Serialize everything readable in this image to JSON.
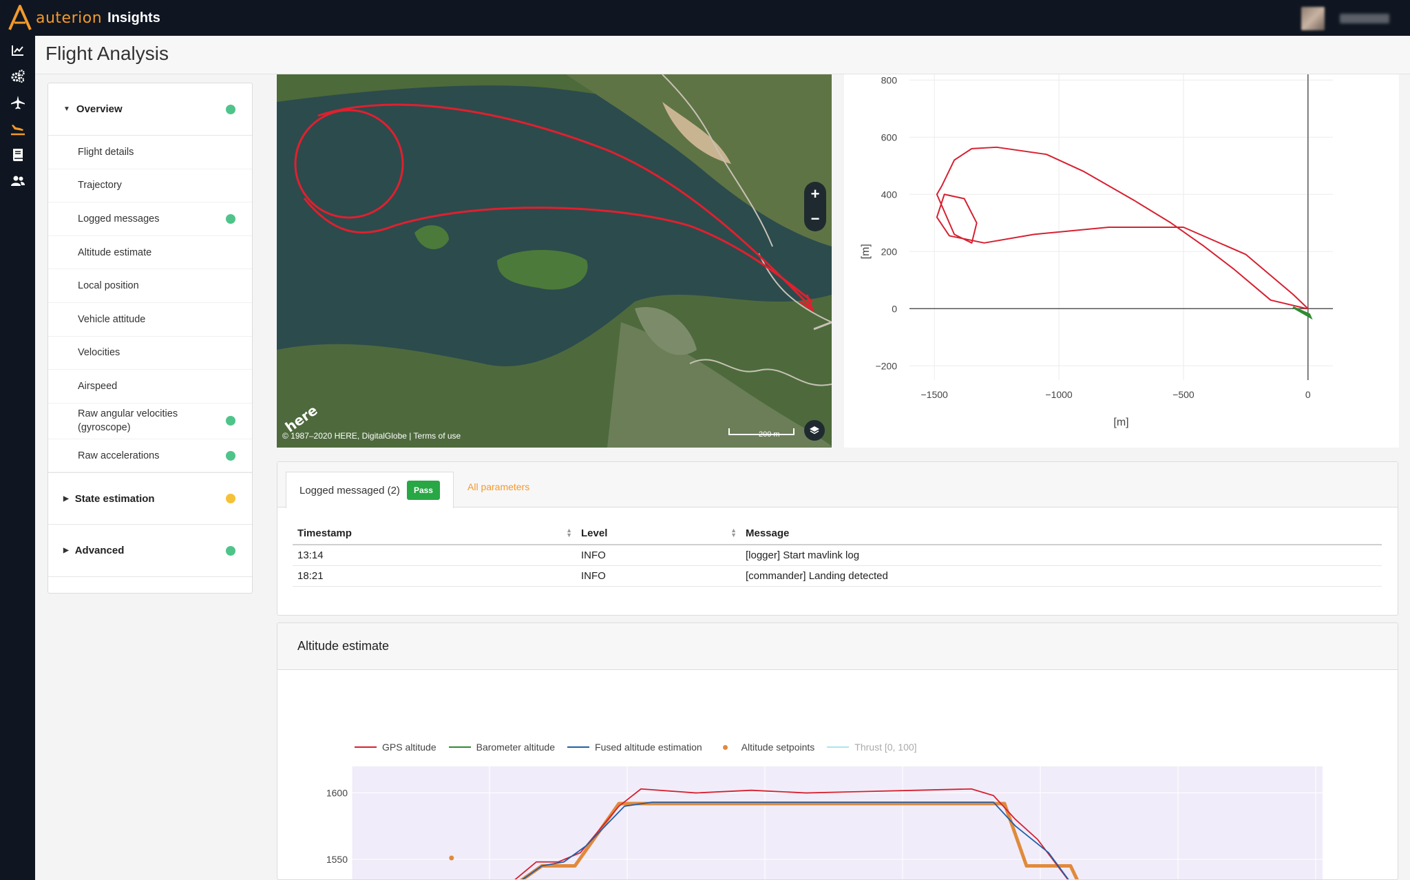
{
  "app": {
    "brand": "auterion",
    "product": "Insights",
    "page_title": "Flight Analysis"
  },
  "nav_icons": [
    "chart-line-icon",
    "cogs-icon",
    "plane-icon",
    "plane-landing-icon",
    "book-icon",
    "users-icon"
  ],
  "sidebar": {
    "sections": [
      {
        "label": "Overview",
        "status": "green",
        "expanded": true
      },
      {
        "label": "State estimation",
        "status": "yellow",
        "expanded": false
      },
      {
        "label": "Advanced",
        "status": "green",
        "expanded": false
      }
    ],
    "items": [
      {
        "label": "Flight details",
        "status": ""
      },
      {
        "label": "Trajectory",
        "status": ""
      },
      {
        "label": "Logged messages",
        "status": "green"
      },
      {
        "label": "Altitude estimate",
        "status": ""
      },
      {
        "label": "Local position",
        "status": ""
      },
      {
        "label": "Vehicle attitude",
        "status": ""
      },
      {
        "label": "Velocities",
        "status": ""
      },
      {
        "label": "Airspeed",
        "status": ""
      },
      {
        "label": "Raw angular velocities (gyroscope)",
        "status": "green"
      },
      {
        "label": "Raw accelerations",
        "status": "green"
      }
    ]
  },
  "map": {
    "zoom_in": "+",
    "zoom_out": "−",
    "attribution": "© 1987–2020 HERE, DigitalGlobe | Terms of use",
    "scale": "200 m",
    "provider_logo": "here"
  },
  "trajectory_plot": {
    "chart_data": {
      "type": "line",
      "xlabel": "[m]",
      "ylabel": "[m]",
      "xticks": [
        "−1500",
        "−1000",
        "−500",
        "0"
      ],
      "yticks": [
        "800",
        "600",
        "400",
        "200",
        "0",
        "−200"
      ],
      "xlim": [
        -1600,
        100
      ],
      "ylim": [
        -250,
        820
      ],
      "series": [
        {
          "color": "#d62030",
          "x": [
            -5,
            -150,
            -300,
            -420,
            -550,
            -700,
            -900,
            -1050,
            -1250,
            -1350,
            -1420,
            -1470,
            -1490,
            -1420,
            -1350,
            -1330,
            -1380,
            -1460,
            -1490,
            -1440,
            -1300,
            -1100,
            -800,
            -500,
            -250,
            -60,
            0
          ],
          "y": [
            0,
            30,
            140,
            220,
            300,
            380,
            480,
            540,
            565,
            560,
            520,
            430,
            400,
            260,
            230,
            300,
            385,
            400,
            320,
            255,
            230,
            260,
            285,
            285,
            190,
            50,
            0
          ]
        }
      ],
      "colors": {
        "track": "#d62030",
        "landing": "#2e8b2e",
        "axis": "#555"
      }
    }
  },
  "messages_panel": {
    "tab_active": "Logged messaged (2)",
    "badge": "Pass",
    "tab_link": "All parameters",
    "columns": [
      "Timestamp",
      "Level",
      "Message"
    ],
    "rows": [
      [
        "13:14",
        "INFO",
        "[logger] Start mavlink log"
      ],
      [
        "18:21",
        "INFO",
        "[commander] Landing detected"
      ]
    ]
  },
  "altitude_panel": {
    "title": "Altitude estimate",
    "legend": [
      {
        "name": "GPS altitude",
        "color": "#d62030",
        "kind": "line"
      },
      {
        "name": "Barometer altitude",
        "color": "#2e8b2e",
        "kind": "line"
      },
      {
        "name": "Fused altitude estimation",
        "color": "#1f5fa8",
        "kind": "line"
      },
      {
        "name": "Altitude setpoints",
        "color": "#e08a3c",
        "kind": "point"
      },
      {
        "name": "Thrust [0, 100]",
        "color": "#a9e6ef",
        "kind": "line"
      }
    ],
    "chart_data": {
      "type": "line",
      "yticks": [
        "1600",
        "1550"
      ],
      "ylim": [
        1510,
        1620
      ],
      "series": [
        {
          "name": "Altitude setpoints",
          "color": "#e08a3c",
          "x": [
            0,
            60,
            70,
            90,
            130,
            470,
            480,
            500,
            540,
            560
          ],
          "y": [
            1510,
            1545,
            1545,
            1545,
            1592,
            1592,
            1592,
            1545,
            1545,
            1510
          ]
        },
        {
          "name": "GPS altitude",
          "color": "#d62030",
          "x": [
            0,
            55,
            75,
            95,
            130,
            150,
            200,
            250,
            300,
            350,
            400,
            450,
            470,
            490,
            510,
            560
          ],
          "y": [
            1510,
            1548,
            1548,
            1555,
            1590,
            1603,
            1600,
            1602,
            1600,
            1601,
            1602,
            1603,
            1598,
            1580,
            1565,
            1510
          ]
        },
        {
          "name": "Fused altitude estimation",
          "color": "#1f5fa8",
          "x": [
            0,
            60,
            80,
            100,
            135,
            160,
            470,
            490,
            520,
            560
          ],
          "y": [
            1510,
            1545,
            1548,
            1560,
            1590,
            1593,
            1593,
            1575,
            1555,
            1510
          ]
        }
      ]
    }
  }
}
